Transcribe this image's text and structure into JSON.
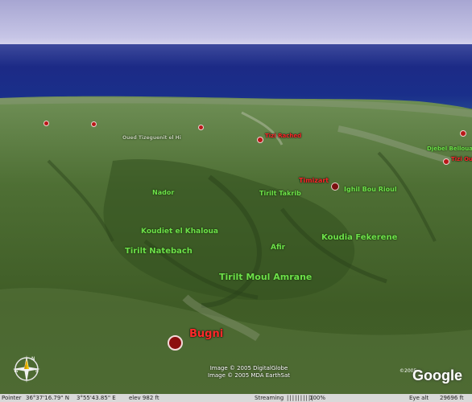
{
  "map": {
    "places": [
      {
        "name": "Bugni",
        "size": "large"
      },
      {
        "name": "Timizart"
      },
      {
        "name": "Tizi Rached"
      },
      {
        "name": "Tizi Ouzou"
      }
    ],
    "place_labels": {
      "bugni": "Bugni",
      "timizart": "Timizart",
      "tizi_rached": "Tizi Rached",
      "right_edge": "Tizi Ou"
    },
    "terrain_labels": {
      "ighil_bou_rioul": "Ighil Bou Rioul",
      "tirilt_takrib": "Tirilt Takrib",
      "nador": "Nador",
      "koudiet_el_khaloua": "Koudiet el Khaloua",
      "tirilt_natebach": "Tirilt Natebach",
      "afir": "Afir",
      "koudia_fekerene": "Koudia Fekerene",
      "tirilt_moul_amrane": "Tirilt Moul Amrane",
      "djebel_belloua": "Djebel Belloua",
      "oued_label": "Oued Tizeguenit el Hi"
    },
    "credits": [
      "Image © 2005 DigitalGlobe",
      "Image © 2005 MDA EarthSat"
    ]
  },
  "logo": {
    "text": "Google",
    "copyright": "©2005"
  },
  "status_bar": {
    "pointer_label": "Pointer",
    "latitude": "36°37'16.79\" N",
    "longitude": "3°55'43.85\" E",
    "elevation": "elev 982 ft",
    "streaming_label": "Streaming",
    "streaming_bars": "||||||||||",
    "streaming_percent": "100%",
    "eye_label": "Eye alt",
    "eye_alt": "29696 ft"
  },
  "colors": {
    "place_dot": "#b81818",
    "place_label": "#ff2a2a",
    "terrain_label": "#6ee04a",
    "sea": "#1c2a86",
    "sky": "#c6c5e6"
  },
  "icons": {
    "compass": "compass-icon",
    "logo": "google-logo"
  }
}
